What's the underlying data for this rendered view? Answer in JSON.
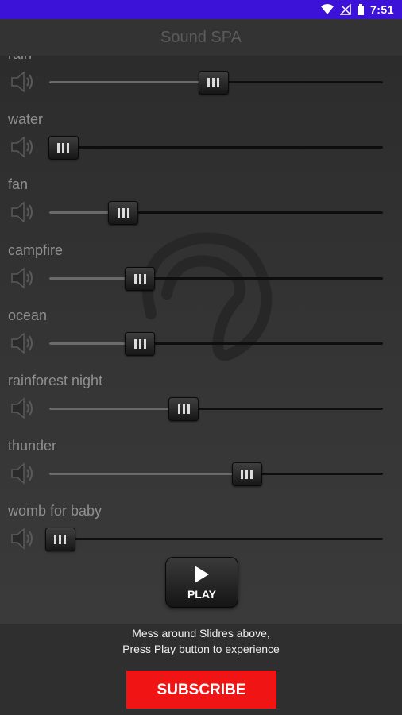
{
  "status_bar": {
    "time": "7:51"
  },
  "app": {
    "title": "Sound SPA"
  },
  "channels": [
    {
      "label": "rain",
      "level": 0.49
    },
    {
      "label": "water",
      "level": 0.04
    },
    {
      "label": "fan",
      "level": 0.22
    },
    {
      "label": "campfire",
      "level": 0.27
    },
    {
      "label": "ocean",
      "level": 0.27
    },
    {
      "label": "rainforest night",
      "level": 0.4
    },
    {
      "label": "thunder",
      "level": 0.59
    },
    {
      "label": "womb for baby",
      "level": 0.03
    }
  ],
  "play_button": {
    "label": "PLAY"
  },
  "hint": {
    "line1": "Mess around Slidres above,",
    "line2": "Press Play button to experience"
  },
  "subscribe_button": {
    "label": "SUBSCRIBE"
  },
  "colors": {
    "status_bar": "#3d12d8",
    "subscribe": "#f01414"
  }
}
